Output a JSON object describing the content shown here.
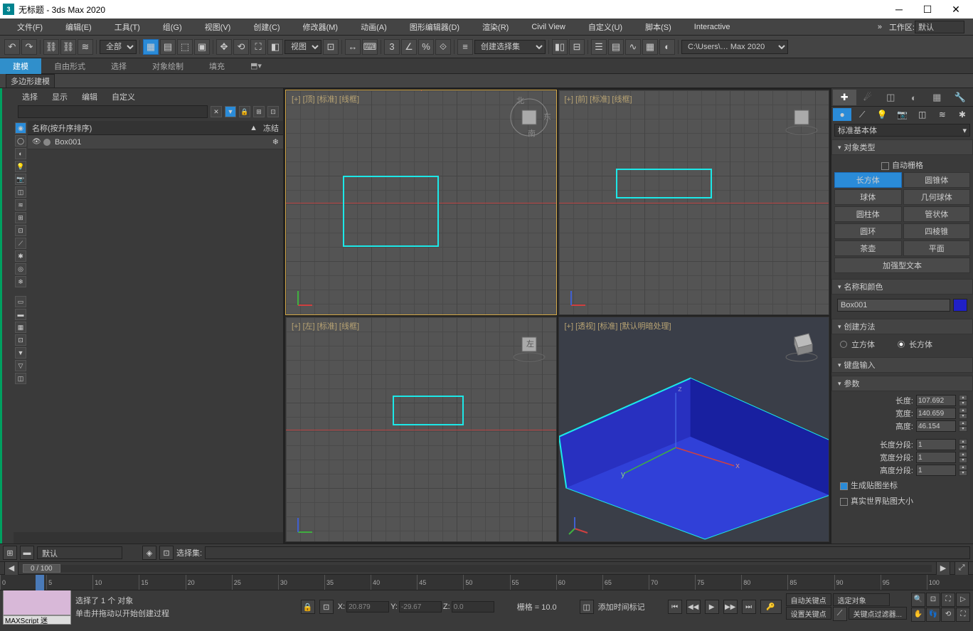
{
  "title": "无标题 - 3ds Max 2020",
  "menu": [
    "文件(F)",
    "编辑(E)",
    "工具(T)",
    "组(G)",
    "视图(V)",
    "创建(C)",
    "修改器(M)",
    "动画(A)",
    "图形编辑器(D)",
    "渲染(R)",
    "Civil View",
    "自定义(U)",
    "脚本(S)",
    "Interactive"
  ],
  "workspace": {
    "label": "工作区:",
    "value": "默认"
  },
  "toolbar": {
    "filter": "全部",
    "view": "视图",
    "selset": "创建选择集",
    "path": "C:\\Users\\… Max 2020"
  },
  "ribbon": {
    "tabs": [
      "建模",
      "自由形式",
      "选择",
      "对象绘制",
      "填充"
    ],
    "sub": "多边形建模"
  },
  "scene": {
    "tabs": [
      "选择",
      "显示",
      "编辑",
      "自定义"
    ],
    "nameCol": "名称(按升序排序)",
    "freezeCol": "冻结",
    "item": "Box001"
  },
  "vp": {
    "top": "[+] [顶] [标准] [线框]",
    "front": "[+] [前] [标准] [线框]",
    "left": "[+] [左] [标准] [线框]",
    "persp": "[+] [透视] [标准] [默认明暗处理]"
  },
  "cmd": {
    "dd": "标准基本体",
    "rollObj": "对象类型",
    "autoGrid": "自动栅格",
    "objs": [
      "长方体",
      "圆锥体",
      "球体",
      "几何球体",
      "圆柱体",
      "管状体",
      "圆环",
      "四棱锥",
      "茶壶",
      "平面",
      "加强型文本"
    ],
    "rollName": "名称和颜色",
    "name": "Box001",
    "rollCreate": "创建方法",
    "cube": "立方体",
    "box": "长方体",
    "rollKb": "键盘输入",
    "rollParam": "参数",
    "p": {
      "len": "长度:",
      "lenV": "107.692",
      "wid": "宽度:",
      "widV": "140.659",
      "hgt": "高度:",
      "hgtV": "46.154",
      "lseg": "长度分段:",
      "lsegV": "1",
      "wseg": "宽度分段:",
      "wsegV": "1",
      "hseg": "高度分段:",
      "hsegV": "1",
      "genUV": "生成贴图坐标",
      "realUV": "真实世界贴图大小"
    }
  },
  "bottom": {
    "layer": "默认",
    "selsetLbl": "选择集:",
    "frame": "0 / 100",
    "ticks": [
      "0",
      "5",
      "10",
      "15",
      "20",
      "25",
      "30",
      "35",
      "40",
      "45",
      "50",
      "55",
      "60",
      "65",
      "70",
      "75",
      "80",
      "85",
      "90",
      "95",
      "100"
    ],
    "status1": "选择了 1 个 对象",
    "status2": "单击并拖动以开始创建过程",
    "maxscript": "MAXScript 迷",
    "x": "20.879",
    "y": "-29.67",
    "z": "0.0",
    "grid": "栅格 = 10.0",
    "addtime": "添加时间标记",
    "autoKey": "自动关键点",
    "selObj": "选定对象",
    "setKey": "设置关键点",
    "keyFilter": "关键点过滤器..."
  }
}
